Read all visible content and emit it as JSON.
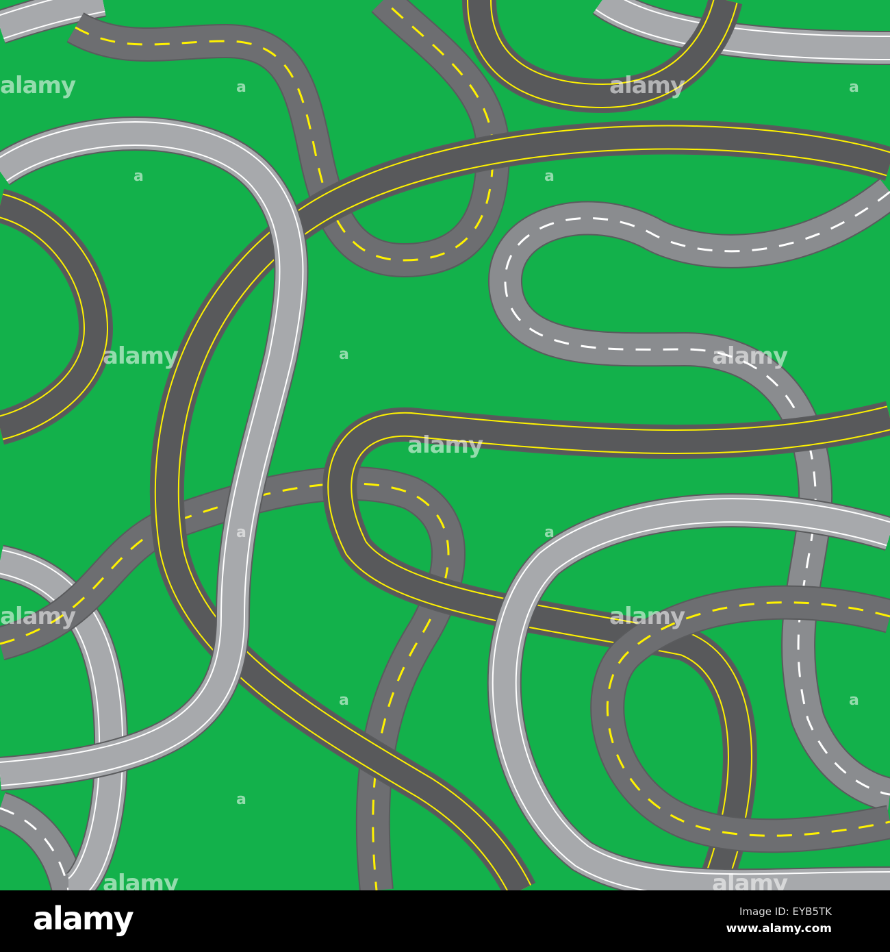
{
  "illustration": {
    "subject": "seamless pattern of winding roads",
    "colors": {
      "grass": "#13b14b",
      "dark_road": "#58595b",
      "mid_road": "#6d6e71",
      "light_road": "#a7a9ac",
      "yellow": "#fff200",
      "white": "#ffffff"
    }
  },
  "watermark": {
    "text": "alamy",
    "mark": "a"
  },
  "footer": {
    "logo": "alamy",
    "image_id": "Image ID: EYB5TK",
    "website": "www.alamy.com"
  }
}
